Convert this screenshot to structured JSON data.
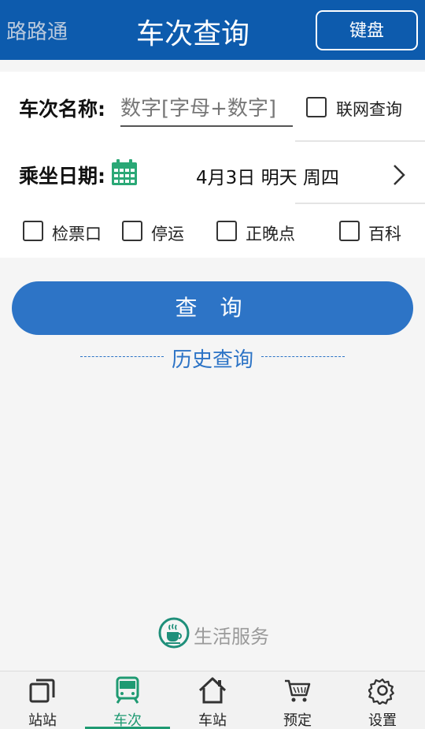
{
  "header": {
    "app_name": "路路通",
    "title": "车次查询",
    "keyboard_button": "键盘",
    "bg_color": "#0d5bad"
  },
  "form": {
    "train_label": "车次名称:",
    "train_input_placeholder": "数字[字母+数字]",
    "train_input_value": "",
    "online_query_label": "联网查询",
    "online_query_checked": false,
    "date_label": "乘坐日期:",
    "date_icon": "calendar-icon",
    "date_value": "4月3日 明天 周四",
    "options": [
      {
        "label": "检票口",
        "checked": false
      },
      {
        "label": "停运",
        "checked": false
      },
      {
        "label": "正晚点",
        "checked": false
      },
      {
        "label": "百科",
        "checked": false
      }
    ]
  },
  "query_button": "查 询",
  "history_link": "历史查询",
  "life_service": {
    "label": "生活服务",
    "icon": "coffee-cup-icon"
  },
  "bottom_nav": {
    "active_index": 1,
    "active_color": "#1f9a72",
    "items": [
      {
        "label": "站站",
        "icon": "station-to-station-icon"
      },
      {
        "label": "车次",
        "icon": "train-icon"
      },
      {
        "label": "车站",
        "icon": "home-station-icon"
      },
      {
        "label": "预定",
        "icon": "shopping-cart-icon"
      },
      {
        "label": "设置",
        "icon": "gear-icon"
      }
    ]
  },
  "colors": {
    "primary_blue": "#2d74c6",
    "accent_green": "#1f9a72"
  }
}
